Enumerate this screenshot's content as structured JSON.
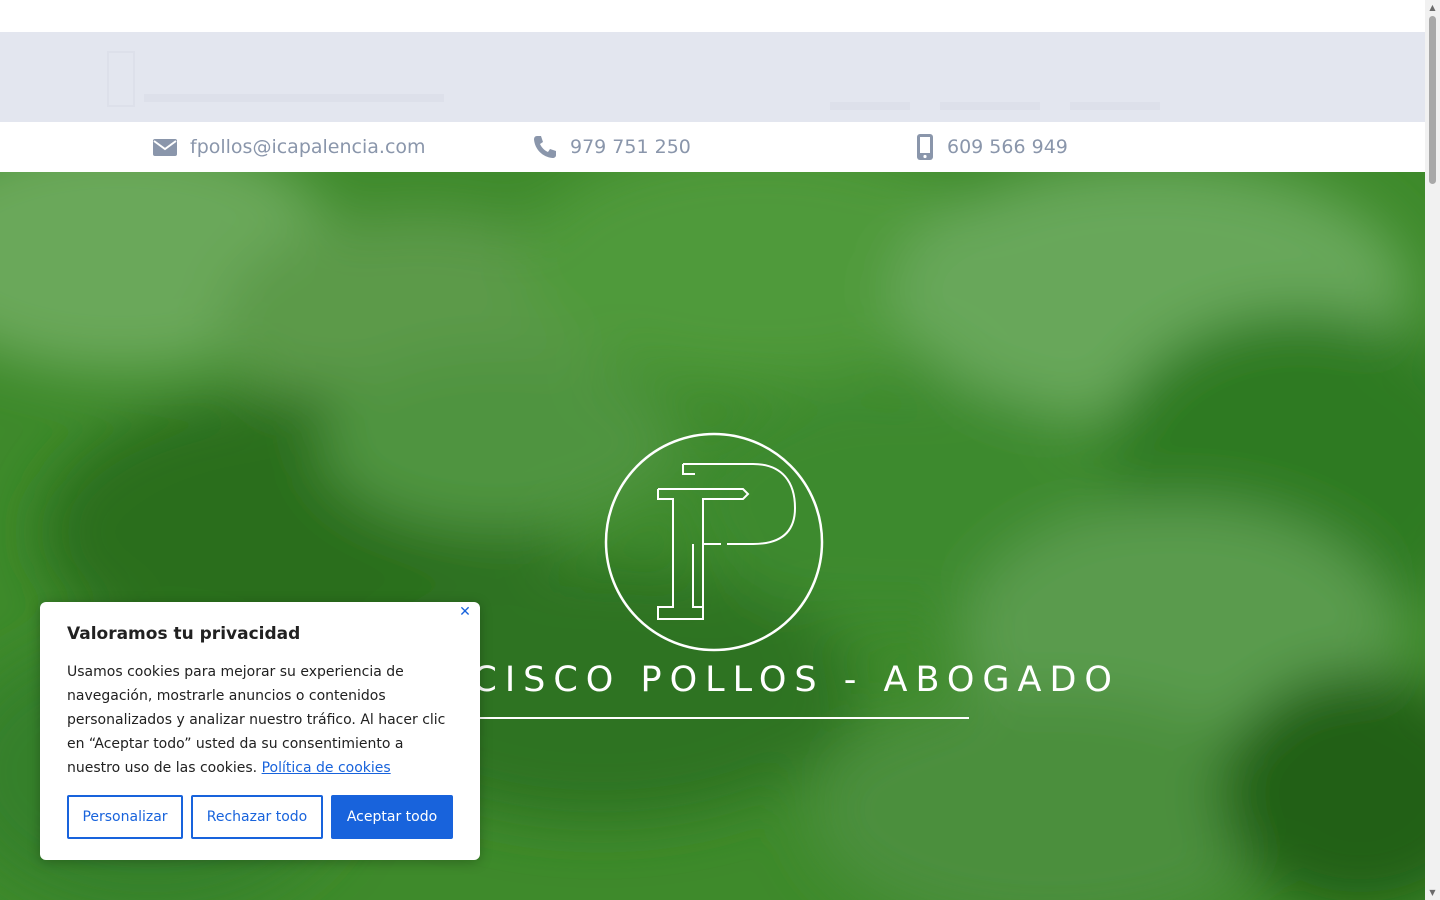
{
  "contact": {
    "email": "fpollos@icapalencia.com",
    "phone": "979 751 250",
    "mobile": "609 566 949"
  },
  "hero": {
    "title": "FRANCISCO POLLOS - ABOGADO"
  },
  "cookie_banner": {
    "title": "Valoramos tu privacidad",
    "body": "Usamos cookies para mejorar su experiencia de navegación, mostrarle anuncios o contenidos personalizados y analizar nuestro tráfico. Al hacer clic en “Aceptar todo” usted da su consentimiento a nuestro uso de las cookies.",
    "policy_link": "Política de cookies",
    "close_label": "✕",
    "buttons": {
      "customize": "Personalizar",
      "reject": "Rechazar todo",
      "accept": "Aceptar todo"
    }
  },
  "scrollbar": {
    "up_arrow": "▲",
    "down_arrow": "▼"
  },
  "colors": {
    "header_bg": "#e3e6ef",
    "contact_text": "#8a96ab",
    "hero_green": "#3f8a2a",
    "cookie_accent": "#1863dc"
  },
  "icons": {
    "email": "envelope-icon",
    "phone": "phone-icon",
    "mobile": "mobile-phone-icon",
    "close": "close-icon"
  }
}
